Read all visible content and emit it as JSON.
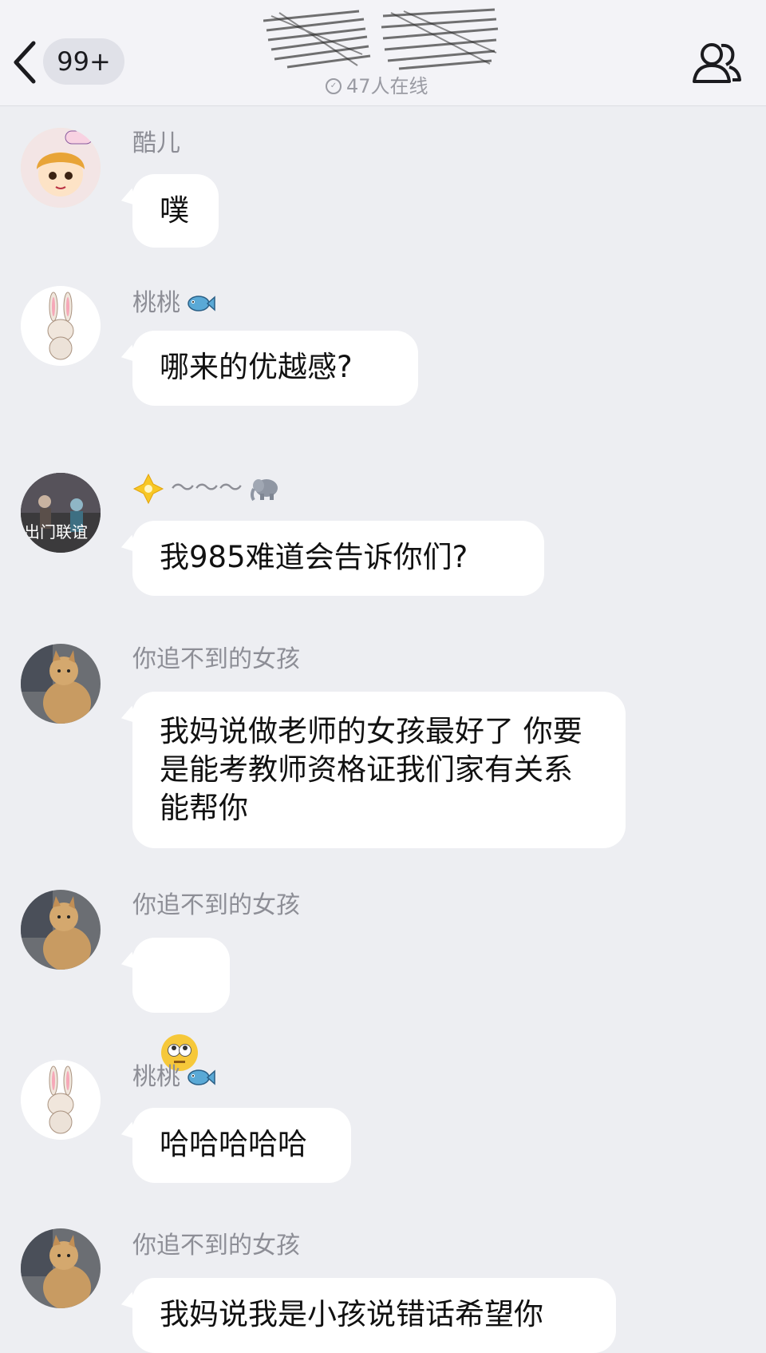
{
  "header": {
    "unread_badge": "99+",
    "online_text": "47人在线",
    "icons": {
      "back": "back-chevron-icon",
      "contacts": "group-members-icon",
      "online": "online-indicator-icon"
    }
  },
  "messages": [
    {
      "sender": "酷儿",
      "text": "噗",
      "avatar": "cartoon-girl-avatar"
    },
    {
      "sender": "桃桃",
      "sender_icon": "fish-icon",
      "text": "哪来的优越感?",
      "avatar": "rabbit-avatar"
    },
    {
      "sender": "～～～",
      "sender_prefix_icon": "sparkle-star-icon",
      "sender_suffix_icon": "elephant-icon",
      "text": "我985难道会告诉你们?",
      "avatar": "game-scene-avatar",
      "avatar_caption": "出门联谊"
    },
    {
      "sender": "你追不到的女孩",
      "text": "我妈说做老师的女孩最好了 你要是能考教师资格证我们家有关系能帮你",
      "avatar": "cat-avatar"
    },
    {
      "sender": "你追不到的女孩",
      "text": "",
      "text_icon": "eye-roll-emoji",
      "avatar": "cat-avatar"
    },
    {
      "sender": "桃桃",
      "sender_icon": "fish-icon",
      "text": "哈哈哈哈哈",
      "avatar": "rabbit-avatar"
    },
    {
      "sender": "你追不到的女孩",
      "text": "我妈说我是小孩说错话希望你",
      "avatar": "cat-avatar"
    }
  ],
  "colors": {
    "background": "#edeef2",
    "bubble": "#ffffff",
    "name": "#8d8e96"
  }
}
